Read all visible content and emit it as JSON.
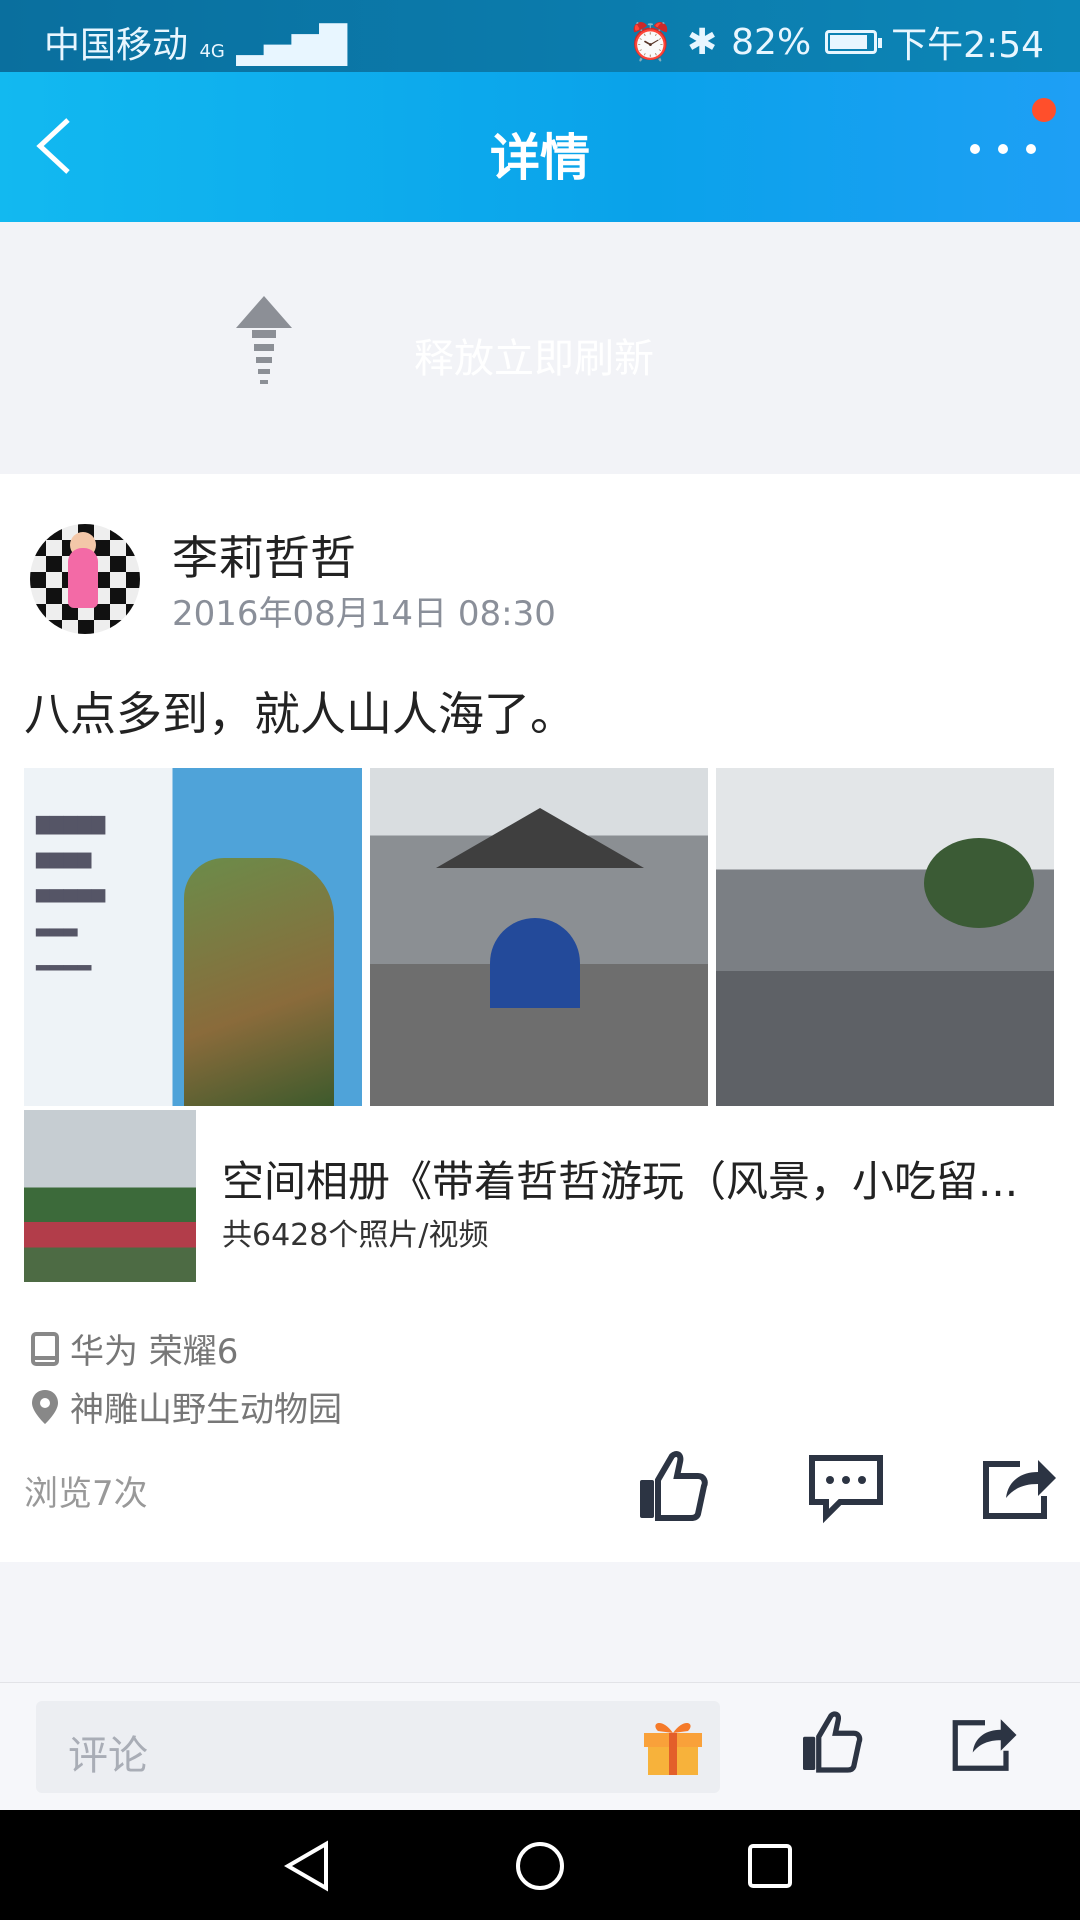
{
  "status_bar": {
    "carrier": "中国移动",
    "network": "4G",
    "battery": "82%",
    "time": "下午2:54"
  },
  "header": {
    "title": "详情"
  },
  "refresh": {
    "text": "释放立即刷新"
  },
  "post": {
    "username": "李莉哲哲",
    "timestamp": "2016年08月14日 08:30",
    "content": "八点多到，就人山人海了。",
    "album": {
      "name": "空间相册《带着哲哲游玩（风景，小吃留...",
      "count": "共6428个照片/视频"
    },
    "device": "华为 荣耀6",
    "location": "神雕山野生动物园",
    "views": "浏览7次"
  },
  "comment_bar": {
    "placeholder": "评论"
  },
  "colors": {
    "header_start": "#12b9f0",
    "header_end": "#1e9ff5",
    "badge": "#ff4f2b"
  },
  "icons": [
    "back-icon",
    "more-icon",
    "refresh-arrow-icon",
    "device-icon",
    "location-icon",
    "like-icon",
    "comment-icon",
    "share-icon",
    "gift-icon",
    "nav-back-icon",
    "nav-home-icon",
    "nav-recent-icon"
  ]
}
